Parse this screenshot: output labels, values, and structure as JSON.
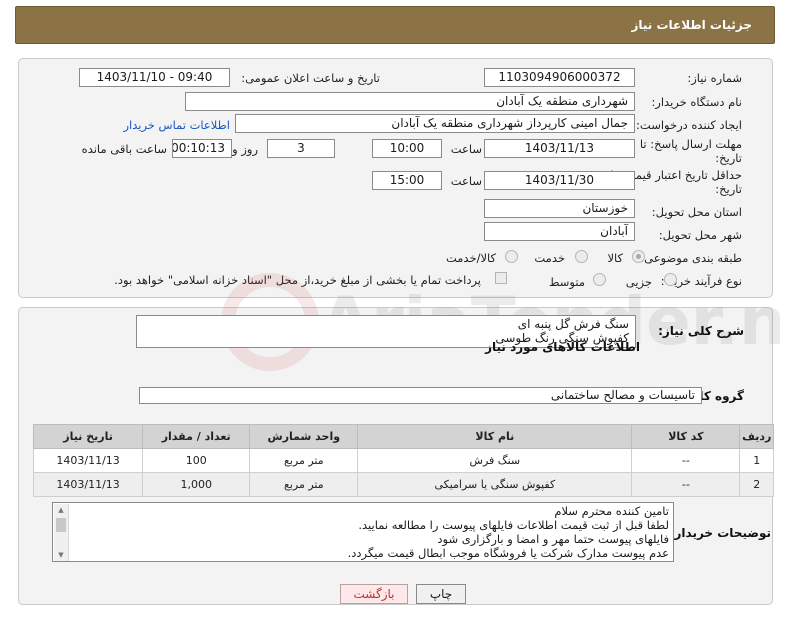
{
  "header": {
    "title": "جزئیات اطلاعات نیاز"
  },
  "form": {
    "need_number_label": "شماره نیاز:",
    "need_number": "1103094906000372",
    "announce_label": "تاریخ و ساعت اعلان عمومی:",
    "announce_value": "1403/11/10 - 09:40",
    "buyer_org_label": "نام دستگاه خریدار:",
    "buyer_org": "شهرداری منطقه یک آبادان",
    "requester_label": "ایجاد کننده درخواست:",
    "requester": "جمال امینی کارپرداز شهرداری منطقه یک آبادان",
    "contact_link": "اطلاعات تماس خریدار",
    "deadline_label": "مهلت ارسال پاسخ: تا تاریخ:",
    "deadline_date": "1403/11/13",
    "time_label": "ساعت",
    "deadline_time": "10:00",
    "days_value": "3",
    "days_label": "روز و",
    "remaining_value": "00:10:13",
    "remaining_label": "ساعت باقی مانده",
    "validity_label": "حداقل تاریخ اعتبار قیمت: تا تاریخ:",
    "validity_date": "1403/11/30",
    "validity_time_label": "ساعت",
    "validity_time": "15:00",
    "province_label": "استان محل تحویل:",
    "province": "خوزستان",
    "city_label": "شهر محل تحویل:",
    "city": "آبادان",
    "category_label": "طبقه بندی موضوعی:",
    "category_options": [
      "کالا",
      "خدمت",
      "کالا/خدمت"
    ],
    "process_label": "نوع فرآیند خرید :",
    "process_options": [
      "جزیی",
      "متوسط"
    ],
    "process_note": "پرداخت تمام یا بخشی از مبلغ خرید،از محل \"اسناد خزانه اسلامی\" خواهد بود."
  },
  "general": {
    "desc_label": "شرح کلی نیاز:",
    "desc_line1": "سنگ فرش گل پنبه ای",
    "desc_line2": "کفپوش سنگی رنگ طوسی",
    "goods_info_title": "اطلاعات کالاهای مورد نیاز",
    "group_label": "گروه کالا:",
    "group_value": "تاسیسات و مصالح ساختمانی"
  },
  "table": {
    "headers": [
      "ردیف",
      "کد کالا",
      "نام کالا",
      "واحد شمارش",
      "تعداد / مقدار",
      "تاریخ نیاز"
    ],
    "rows": [
      [
        "1",
        "--",
        "سنگ فرش",
        "متر مربع",
        "100",
        "1403/11/13"
      ],
      [
        "2",
        "--",
        "کفپوش سنگی یا سرامیکی",
        "متر مربع",
        "1,000",
        "1403/11/13"
      ]
    ]
  },
  "buyer_notes": {
    "label": "توضیحات خریدار:",
    "lines": [
      "تامین کننده محترم سلام",
      "لطفا قبل از ثبت قیمت اطلاعات فایلهای پیوست را مطالعه نمایید.",
      "فایلهای پیوست حتما مهر و امضا و بارگزاری شود",
      "عدم پیوست مدارک شرکت یا فروشگاه موجب ابطال قیمت میگردد."
    ]
  },
  "buttons": {
    "print": "چاپ",
    "back": "بازگشت"
  },
  "watermark": {
    "text": "AriaTender.neT"
  }
}
